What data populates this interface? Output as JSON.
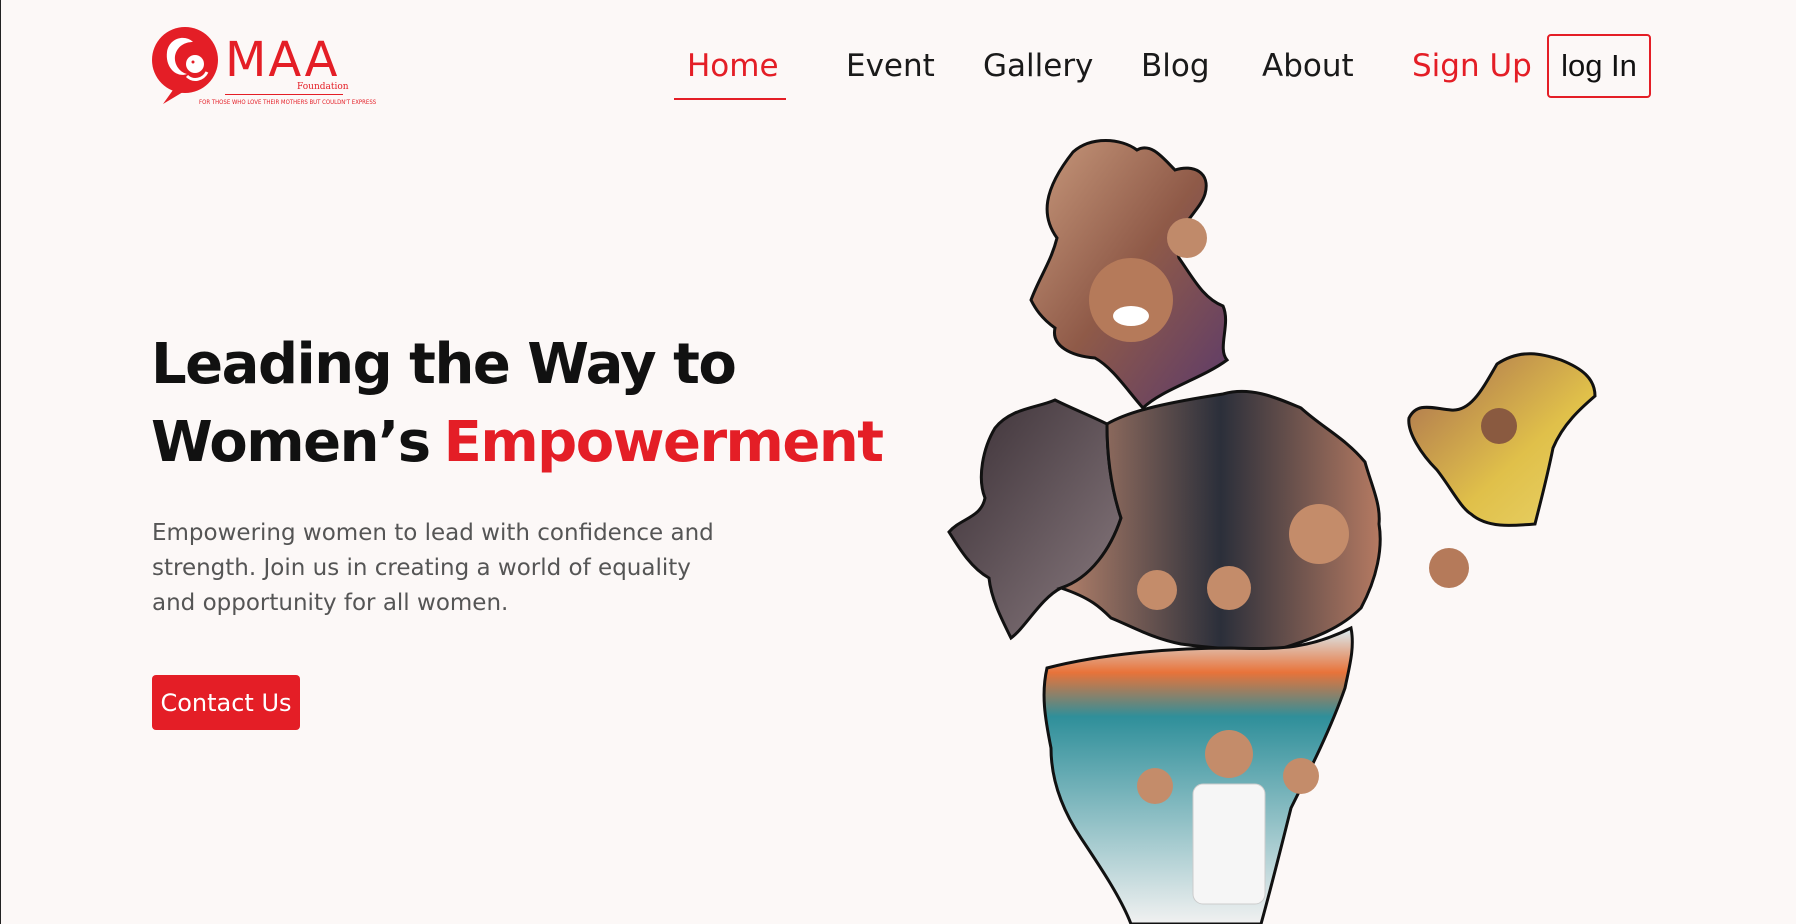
{
  "brand": {
    "name": "MAA",
    "sub": "Foundation",
    "tagline": "FOR THOSE WHO LOVE THEIR MOTHERS BUT COULDN'T EXPRESS",
    "color": "#e41e26"
  },
  "nav": {
    "home": "Home",
    "event": "Event",
    "gallery": "Gallery",
    "blog": "Blog",
    "about": "About",
    "signup": "Sign Up",
    "login": "log In"
  },
  "hero": {
    "title_line1": "Leading the Way to",
    "title_line2": "Women’s",
    "title_accent": "Empowerment",
    "description": "Empowering women to lead with confidence and strength. Join us in creating a world of equality and opportunity for all women.",
    "cta": "Contact Us"
  },
  "map": {
    "icon": "india-map-photo-collage",
    "colors": {
      "north": "#b8836a",
      "central": "#7a4f5a",
      "east": "#c9a24a",
      "south": "#2f8f9a",
      "outline": "#111111"
    }
  }
}
